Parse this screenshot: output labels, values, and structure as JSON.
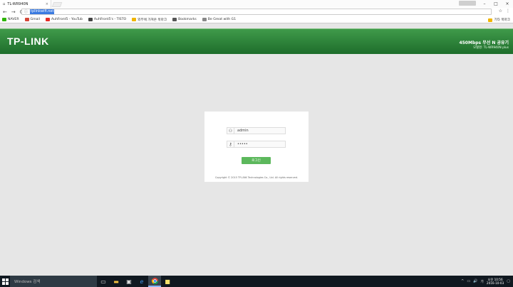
{
  "browser": {
    "tab_title": "TL-WR940N",
    "tab_close": "×",
    "user_badge": "",
    "window_controls": [
      "–",
      "□",
      "×"
    ],
    "nav": {
      "back": "←",
      "forward": "→",
      "reload": "C"
    },
    "url": "tplinkwifi.net",
    "toolbar_icons": [
      "☆",
      "⋮"
    ],
    "bookmarks": [
      {
        "label": "NAVER",
        "color": "#2db400"
      },
      {
        "label": "Gmail",
        "color": "#d44638"
      },
      {
        "label": "AuhFront5 - YouTub",
        "color": "#e52d27"
      },
      {
        "label": "AuhFront5's - TISTO",
        "color": "#444444"
      },
      {
        "label": "외부에 가져온 북마크",
        "color": "#f0b400"
      },
      {
        "label": "Bookmarks",
        "color": "#555555"
      },
      {
        "label": "Be Great with G1",
        "color": "#888888"
      }
    ],
    "other_bookmarks": "기타 북마크"
  },
  "router": {
    "brand": "TP-LINK",
    "model_title": "450Mbps 무선 N 공유기",
    "model_sub": "모델명: TL-WR940N plus",
    "username_value": "admin",
    "password_value": "•••••",
    "login_label": "로그인",
    "copyright": "Copyright © 2015 TP-LINK Technologies Co., Ltd. All rights reserved."
  },
  "taskbar": {
    "search_placeholder": "Windows 검색",
    "clock_time": "오전 10:56",
    "clock_date": "2016-10-03",
    "tray_icons": [
      "^",
      "▭",
      "🔊",
      "가"
    ]
  },
  "colors": {
    "header_green": "#2a7f36",
    "login_green": "#5cb85c",
    "taskbar": "#101820"
  }
}
